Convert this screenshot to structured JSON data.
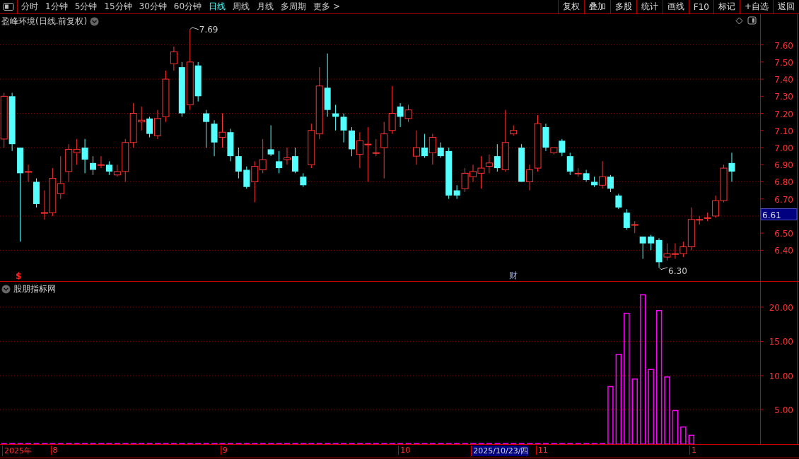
{
  "toolbar": {
    "periods": [
      {
        "label": "分时",
        "selected": false
      },
      {
        "label": "1分钟",
        "selected": false
      },
      {
        "label": "5分钟",
        "selected": false
      },
      {
        "label": "15分钟",
        "selected": false
      },
      {
        "label": "30分钟",
        "selected": false
      },
      {
        "label": "60分钟",
        "selected": false
      },
      {
        "label": "日线",
        "selected": true
      },
      {
        "label": "周线",
        "selected": false
      },
      {
        "label": "月线",
        "selected": false
      },
      {
        "label": "多周期",
        "selected": false
      },
      {
        "label": "更多 >",
        "selected": false
      }
    ],
    "tools": [
      "复权",
      "叠加",
      "多股",
      "统计",
      "画线",
      "F10",
      "标记",
      "+自选",
      "返回"
    ]
  },
  "main_chart": {
    "title": "盈峰环境(日线.前复权)",
    "high_label": "7.69",
    "low_label": "6.30",
    "current_price": "6.61",
    "event_marker": "财",
    "dividend_marker": "$",
    "chart_data": {
      "type": "candlestick",
      "grid": true,
      "ohlc": [
        [
          7.05,
          7.32,
          7.0,
          7.3
        ],
        [
          7.3,
          7.32,
          6.98,
          7.02
        ],
        [
          7.0,
          7.0,
          6.45,
          6.85
        ],
        [
          6.86,
          6.9,
          6.8,
          6.86
        ],
        [
          6.8,
          6.82,
          6.65,
          6.67
        ],
        [
          6.62,
          6.75,
          6.58,
          6.62
        ],
        [
          6.62,
          6.88,
          6.6,
          6.82
        ],
        [
          6.73,
          6.95,
          6.7,
          6.79
        ],
        [
          6.86,
          7.02,
          6.8,
          6.99
        ],
        [
          6.97,
          7.05,
          6.9,
          6.99
        ],
        [
          7.0,
          7.05,
          6.85,
          6.93
        ],
        [
          6.91,
          6.95,
          6.84,
          6.87
        ],
        [
          6.9,
          6.95,
          6.88,
          6.9
        ],
        [
          6.9,
          6.92,
          6.84,
          6.86
        ],
        [
          6.84,
          6.9,
          6.83,
          6.86
        ],
        [
          6.86,
          7.05,
          6.8,
          7.03
        ],
        [
          7.03,
          7.26,
          7.0,
          7.2
        ],
        [
          7.15,
          7.24,
          7.1,
          7.16
        ],
        [
          7.17,
          7.18,
          7.06,
          7.08
        ],
        [
          7.07,
          7.22,
          7.05,
          7.17
        ],
        [
          7.18,
          7.45,
          7.15,
          7.4
        ],
        [
          7.49,
          7.59,
          7.45,
          7.56
        ],
        [
          7.47,
          7.5,
          7.18,
          7.2
        ],
        [
          7.25,
          7.69,
          7.22,
          7.5
        ],
        [
          7.48,
          7.5,
          7.27,
          7.3
        ],
        [
          7.2,
          7.22,
          7.0,
          7.15
        ],
        [
          7.14,
          7.16,
          6.95,
          7.03
        ],
        [
          7.06,
          7.2,
          7.0,
          7.09
        ],
        [
          7.09,
          7.11,
          6.92,
          6.95
        ],
        [
          6.95,
          7.0,
          6.82,
          6.86
        ],
        [
          6.87,
          6.89,
          6.76,
          6.77
        ],
        [
          6.8,
          6.92,
          6.68,
          6.89
        ],
        [
          6.87,
          7.05,
          6.85,
          6.93
        ],
        [
          6.99,
          7.13,
          6.95,
          6.96
        ],
        [
          6.92,
          6.98,
          6.85,
          6.88
        ],
        [
          6.93,
          7.0,
          6.9,
          6.94
        ],
        [
          6.95,
          7.0,
          6.85,
          6.86
        ],
        [
          6.83,
          6.85,
          6.77,
          6.78
        ],
        [
          6.9,
          7.14,
          6.88,
          7.1
        ],
        [
          7.08,
          7.47,
          7.05,
          7.36
        ],
        [
          7.35,
          7.55,
          7.18,
          7.22
        ],
        [
          7.2,
          7.25,
          7.1,
          7.18
        ],
        [
          7.18,
          7.2,
          7.03,
          7.1
        ],
        [
          7.1,
          7.12,
          6.95,
          6.99
        ],
        [
          6.96,
          7.09,
          6.88,
          7.04
        ],
        [
          7.02,
          7.12,
          6.8,
          7.02
        ],
        [
          6.97,
          7.05,
          6.95,
          6.97
        ],
        [
          7.0,
          7.15,
          6.82,
          7.08
        ],
        [
          7.1,
          7.36,
          7.08,
          7.2
        ],
        [
          7.24,
          7.26,
          7.12,
          7.18
        ],
        [
          7.17,
          7.25,
          7.15,
          7.22
        ],
        [
          6.95,
          7.1,
          6.9,
          7.0
        ],
        [
          7.0,
          7.08,
          6.94,
          6.95
        ],
        [
          6.97,
          7.08,
          6.9,
          7.06
        ],
        [
          7.0,
          7.03,
          6.94,
          6.95
        ],
        [
          6.98,
          7.0,
          6.7,
          6.72
        ],
        [
          6.75,
          6.78,
          6.7,
          6.72
        ],
        [
          6.76,
          6.88,
          6.74,
          6.85
        ],
        [
          6.83,
          6.9,
          6.8,
          6.86
        ],
        [
          6.85,
          6.95,
          6.76,
          6.88
        ],
        [
          6.89,
          6.96,
          6.85,
          6.91
        ],
        [
          6.95,
          7.02,
          6.86,
          6.88
        ],
        [
          6.87,
          7.22,
          6.86,
          7.03
        ],
        [
          7.08,
          7.13,
          7.07,
          7.1
        ],
        [
          7.0,
          7.02,
          6.8,
          6.8
        ],
        [
          6.8,
          6.9,
          6.75,
          6.87
        ],
        [
          6.88,
          7.19,
          6.86,
          7.14
        ],
        [
          7.12,
          7.14,
          6.98,
          7.0
        ],
        [
          6.97,
          7.0,
          6.96,
          7.0
        ],
        [
          7.04,
          7.05,
          6.95,
          6.97
        ],
        [
          6.95,
          6.97,
          6.84,
          6.86
        ],
        [
          6.85,
          6.88,
          6.83,
          6.85
        ],
        [
          6.85,
          6.87,
          6.8,
          6.81
        ],
        [
          6.8,
          6.83,
          6.77,
          6.78
        ],
        [
          6.78,
          6.92,
          6.76,
          6.83
        ],
        [
          6.83,
          6.84,
          6.74,
          6.76
        ],
        [
          6.72,
          6.73,
          6.64,
          6.65
        ],
        [
          6.62,
          6.64,
          6.52,
          6.53
        ],
        [
          6.55,
          6.57,
          6.5,
          6.55
        ],
        [
          6.48,
          6.48,
          6.35,
          6.44
        ],
        [
          6.48,
          6.49,
          6.4,
          6.44
        ],
        [
          6.46,
          6.47,
          6.3,
          6.33
        ],
        [
          6.36,
          6.44,
          6.34,
          6.38
        ],
        [
          6.38,
          6.44,
          6.35,
          6.38
        ],
        [
          6.38,
          6.45,
          6.36,
          6.42
        ],
        [
          6.42,
          6.65,
          6.4,
          6.58
        ],
        [
          6.58,
          6.6,
          6.55,
          6.58
        ],
        [
          6.59,
          6.62,
          6.57,
          6.59
        ],
        [
          6.6,
          6.72,
          6.59,
          6.69
        ],
        [
          6.69,
          6.9,
          6.68,
          6.88
        ],
        [
          6.91,
          6.97,
          6.8,
          6.86
        ]
      ],
      "ylim": [
        6.22,
        7.78
      ],
      "yticks": [
        {
          "value": 7.6,
          "label": "7.60"
        },
        {
          "value": 7.5,
          "label": "7.50"
        },
        {
          "value": 7.4,
          "label": "7.40"
        },
        {
          "value": 7.3,
          "label": "7.30"
        },
        {
          "value": 7.2,
          "label": "7.20"
        },
        {
          "value": 7.1,
          "label": "7.10"
        },
        {
          "value": 7.0,
          "label": "7.00"
        },
        {
          "value": 6.9,
          "label": "6.90"
        },
        {
          "value": 6.8,
          "label": "6.80"
        },
        {
          "value": 6.7,
          "label": "6.70"
        },
        {
          "value": 6.5,
          "label": "6.50"
        },
        {
          "value": 6.4,
          "label": "6.40"
        }
      ]
    }
  },
  "indicator_chart": {
    "chart_data": {
      "type": "bar",
      "title": "股朋指标网",
      "values": [
        0,
        0,
        0,
        0,
        0,
        0,
        0,
        0,
        0,
        0,
        0,
        0,
        0,
        0,
        0,
        0,
        0,
        0,
        0,
        0,
        0,
        0,
        0,
        0,
        0,
        0,
        0,
        0,
        0,
        0,
        0,
        0,
        0,
        0,
        0,
        0,
        0,
        0,
        0,
        0,
        0,
        0,
        0,
        0,
        0,
        0,
        0,
        0,
        0,
        0,
        0,
        0,
        0,
        0,
        0,
        0,
        0,
        0,
        0,
        0,
        0,
        0,
        0,
        0,
        0,
        0,
        0,
        0,
        0,
        0,
        0,
        0,
        0,
        0,
        0,
        8.4,
        13.1,
        19.1,
        9.5,
        21.8,
        10.9,
        19.5,
        9.8,
        4.9,
        2.5,
        1.3,
        null,
        null,
        null,
        null,
        null,
        null,
        null,
        null
      ],
      "ylim": [
        0,
        23.7
      ],
      "grid": true,
      "yticks": [
        {
          "value": 20,
          "label": "20.00"
        },
        {
          "value": 15,
          "label": "15.00"
        },
        {
          "value": 10,
          "label": "10.00"
        },
        {
          "value": 5,
          "label": "5.00"
        }
      ]
    }
  },
  "date_axis": [
    {
      "label": "2025年",
      "highlighted": false
    },
    {
      "label": "8",
      "highlighted": false
    },
    {
      "label": "9",
      "highlighted": false
    },
    {
      "label": "10",
      "highlighted": false
    },
    {
      "label": "2025/10/23/四",
      "highlighted": true
    },
    {
      "label": "11",
      "highlighted": false
    },
    {
      "label": "1",
      "highlighted": false
    }
  ]
}
